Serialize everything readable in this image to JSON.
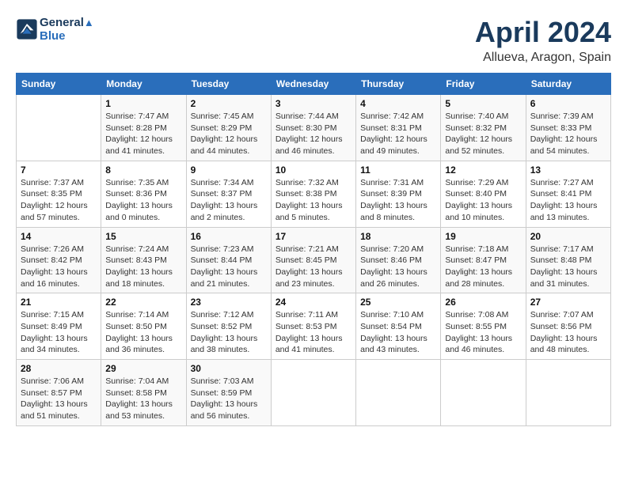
{
  "header": {
    "logo_line1": "General",
    "logo_line2": "Blue",
    "month": "April 2024",
    "location": "Allueva, Aragon, Spain"
  },
  "days_of_week": [
    "Sunday",
    "Monday",
    "Tuesday",
    "Wednesday",
    "Thursday",
    "Friday",
    "Saturday"
  ],
  "weeks": [
    [
      {
        "day": "",
        "info": ""
      },
      {
        "day": "1",
        "info": "Sunrise: 7:47 AM\nSunset: 8:28 PM\nDaylight: 12 hours\nand 41 minutes."
      },
      {
        "day": "2",
        "info": "Sunrise: 7:45 AM\nSunset: 8:29 PM\nDaylight: 12 hours\nand 44 minutes."
      },
      {
        "day": "3",
        "info": "Sunrise: 7:44 AM\nSunset: 8:30 PM\nDaylight: 12 hours\nand 46 minutes."
      },
      {
        "day": "4",
        "info": "Sunrise: 7:42 AM\nSunset: 8:31 PM\nDaylight: 12 hours\nand 49 minutes."
      },
      {
        "day": "5",
        "info": "Sunrise: 7:40 AM\nSunset: 8:32 PM\nDaylight: 12 hours\nand 52 minutes."
      },
      {
        "day": "6",
        "info": "Sunrise: 7:39 AM\nSunset: 8:33 PM\nDaylight: 12 hours\nand 54 minutes."
      }
    ],
    [
      {
        "day": "7",
        "info": "Sunrise: 7:37 AM\nSunset: 8:35 PM\nDaylight: 12 hours\nand 57 minutes."
      },
      {
        "day": "8",
        "info": "Sunrise: 7:35 AM\nSunset: 8:36 PM\nDaylight: 13 hours\nand 0 minutes."
      },
      {
        "day": "9",
        "info": "Sunrise: 7:34 AM\nSunset: 8:37 PM\nDaylight: 13 hours\nand 2 minutes."
      },
      {
        "day": "10",
        "info": "Sunrise: 7:32 AM\nSunset: 8:38 PM\nDaylight: 13 hours\nand 5 minutes."
      },
      {
        "day": "11",
        "info": "Sunrise: 7:31 AM\nSunset: 8:39 PM\nDaylight: 13 hours\nand 8 minutes."
      },
      {
        "day": "12",
        "info": "Sunrise: 7:29 AM\nSunset: 8:40 PM\nDaylight: 13 hours\nand 10 minutes."
      },
      {
        "day": "13",
        "info": "Sunrise: 7:27 AM\nSunset: 8:41 PM\nDaylight: 13 hours\nand 13 minutes."
      }
    ],
    [
      {
        "day": "14",
        "info": "Sunrise: 7:26 AM\nSunset: 8:42 PM\nDaylight: 13 hours\nand 16 minutes."
      },
      {
        "day": "15",
        "info": "Sunrise: 7:24 AM\nSunset: 8:43 PM\nDaylight: 13 hours\nand 18 minutes."
      },
      {
        "day": "16",
        "info": "Sunrise: 7:23 AM\nSunset: 8:44 PM\nDaylight: 13 hours\nand 21 minutes."
      },
      {
        "day": "17",
        "info": "Sunrise: 7:21 AM\nSunset: 8:45 PM\nDaylight: 13 hours\nand 23 minutes."
      },
      {
        "day": "18",
        "info": "Sunrise: 7:20 AM\nSunset: 8:46 PM\nDaylight: 13 hours\nand 26 minutes."
      },
      {
        "day": "19",
        "info": "Sunrise: 7:18 AM\nSunset: 8:47 PM\nDaylight: 13 hours\nand 28 minutes."
      },
      {
        "day": "20",
        "info": "Sunrise: 7:17 AM\nSunset: 8:48 PM\nDaylight: 13 hours\nand 31 minutes."
      }
    ],
    [
      {
        "day": "21",
        "info": "Sunrise: 7:15 AM\nSunset: 8:49 PM\nDaylight: 13 hours\nand 34 minutes."
      },
      {
        "day": "22",
        "info": "Sunrise: 7:14 AM\nSunset: 8:50 PM\nDaylight: 13 hours\nand 36 minutes."
      },
      {
        "day": "23",
        "info": "Sunrise: 7:12 AM\nSunset: 8:52 PM\nDaylight: 13 hours\nand 38 minutes."
      },
      {
        "day": "24",
        "info": "Sunrise: 7:11 AM\nSunset: 8:53 PM\nDaylight: 13 hours\nand 41 minutes."
      },
      {
        "day": "25",
        "info": "Sunrise: 7:10 AM\nSunset: 8:54 PM\nDaylight: 13 hours\nand 43 minutes."
      },
      {
        "day": "26",
        "info": "Sunrise: 7:08 AM\nSunset: 8:55 PM\nDaylight: 13 hours\nand 46 minutes."
      },
      {
        "day": "27",
        "info": "Sunrise: 7:07 AM\nSunset: 8:56 PM\nDaylight: 13 hours\nand 48 minutes."
      }
    ],
    [
      {
        "day": "28",
        "info": "Sunrise: 7:06 AM\nSunset: 8:57 PM\nDaylight: 13 hours\nand 51 minutes."
      },
      {
        "day": "29",
        "info": "Sunrise: 7:04 AM\nSunset: 8:58 PM\nDaylight: 13 hours\nand 53 minutes."
      },
      {
        "day": "30",
        "info": "Sunrise: 7:03 AM\nSunset: 8:59 PM\nDaylight: 13 hours\nand 56 minutes."
      },
      {
        "day": "",
        "info": ""
      },
      {
        "day": "",
        "info": ""
      },
      {
        "day": "",
        "info": ""
      },
      {
        "day": "",
        "info": ""
      }
    ]
  ]
}
